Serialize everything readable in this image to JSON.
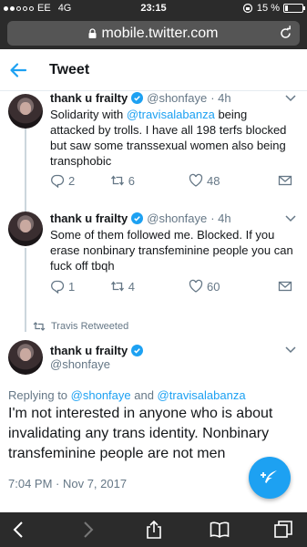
{
  "status_bar": {
    "carrier": "EE",
    "network": "4G",
    "time": "23:15",
    "battery_text": "15 %",
    "battery_level": 0.15
  },
  "browser": {
    "url": "mobile.twitter.com"
  },
  "header": {
    "title": "Tweet"
  },
  "tweets": [
    {
      "name": "thank u frailty",
      "handle": "@shonfaye",
      "time": "· 4h",
      "text_before": "Solidarity with ",
      "mention": "@travisalabanza",
      "text_after": " being attacked by trolls. I have all 198 terfs blocked but saw some transsexual women also being transphobic",
      "replies": "2",
      "retweets": "6",
      "likes": "48"
    },
    {
      "name": "thank u frailty",
      "handle": "@shonfaye",
      "time": "· 4h",
      "text": "Some of them followed me. Blocked. If you erase nonbinary transfeminine people you can fuck off tbqh",
      "replies": "1",
      "retweets": "4",
      "likes": "60"
    }
  ],
  "retweeted_label": "Travis Retweeted",
  "main_tweet": {
    "name": "thank u frailty",
    "handle": "@shonfaye",
    "replying_prefix": "Replying to ",
    "replying_user1": "@shonfaye",
    "replying_and": " and ",
    "replying_user2": "@travisalabanza",
    "text": "I'm not interested in anyone who is about invalidating any trans identity. Nonbinary transfeminine people are not men",
    "timestamp": "7:04 PM · Nov 7, 2017"
  },
  "colors": {
    "accent": "#1da1f2",
    "chrome": "#2b2b2b",
    "muted": "#657786"
  }
}
